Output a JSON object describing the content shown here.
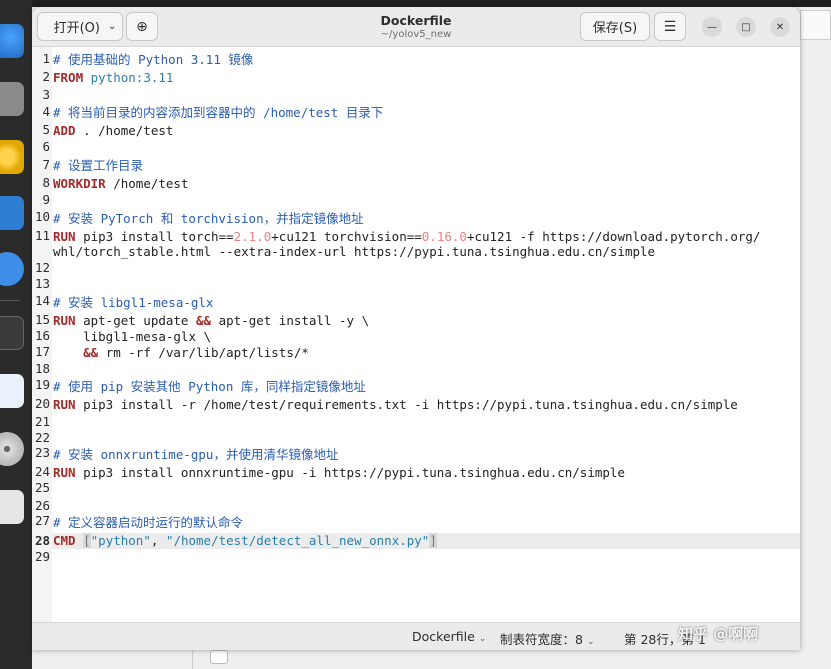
{
  "window": {
    "title": "Dockerfile",
    "subtitle": "~/yolov5_new"
  },
  "header": {
    "open_label": "打开(O)",
    "save_label": "保存(S)"
  },
  "code": {
    "line_numbers": [
      "1",
      "2",
      "3",
      "4",
      "5",
      "6",
      "7",
      "8",
      "9",
      "10",
      "11",
      "",
      "12",
      "13",
      "14",
      "15",
      "16",
      "17",
      "18",
      "19",
      "20",
      "21",
      "22",
      "23",
      "24",
      "25",
      "26",
      "27",
      "28",
      "29"
    ],
    "l1": "# 使用基础的 Python 3.11 镜像",
    "l2_kw": "FROM",
    "l2_val": "python:3.11",
    "l4": "# 将当前目录的内容添加到容器中的 /home/test 目录下",
    "l5_kw": "ADD",
    "l5_rest": " . /home/test",
    "l7": "# 设置工作目录",
    "l8_kw": "WORKDIR",
    "l8_rest": " /home/test",
    "l10": "# 安装 PyTorch 和 torchvision，并指定镜像地址",
    "l11_kw": "RUN",
    "l11_a": " pip3 install torch==",
    "l11_v1": "2.1.0",
    "l11_b": "+cu121 torchvision==",
    "l11_v2": "0.16.0",
    "l11_c": "+cu121 -f https://download.pytorch.org/",
    "l11_wrap": "whl/torch_stable.html --extra-index-url https://pypi.tuna.tsinghua.edu.cn/simple",
    "l14": "# 安装 libgl1-mesa-glx",
    "l15_kw": "RUN",
    "l15_a": " apt-get update ",
    "l15_op": "&&",
    "l15_b": " apt-get install -y \\",
    "l16": "    libgl1-mesa-glx \\",
    "l17_pre": "    ",
    "l17_op": "&&",
    "l17_rest": " rm -rf /var/lib/apt/lists/*",
    "l19": "# 使用 pip 安装其他 Python 库，同样指定镜像地址",
    "l20_kw": "RUN",
    "l20_rest": " pip3 install -r /home/test/requirements.txt -i https://pypi.tuna.tsinghua.edu.cn/simple",
    "l23": "# 安装 onnxruntime-gpu，并使用清华镜像地址",
    "l24_kw": "RUN",
    "l24_rest": " pip3 install onnxruntime-gpu -i https://pypi.tuna.tsinghua.edu.cn/simple",
    "l27": "# 定义容器启动时运行的默认命令",
    "l28_kw": "CMD",
    "l28_open": "[",
    "l28_s1": "\"python\"",
    "l28_sep": ", ",
    "l28_s2": "\"/home/test/detect_all_new_onnx.py\"",
    "l28_close": "]"
  },
  "statusbar": {
    "language": "Dockerfile",
    "tab_width": "制表符宽度：8",
    "position": "第 28行，第 1"
  },
  "watermark": "知乎 @啊啊",
  "icons": {
    "new_tab": "new-tab-icon",
    "menu": "hamburger-menu-icon",
    "minimize": "minimize-icon",
    "maximize": "maximize-icon",
    "close": "close-icon"
  }
}
